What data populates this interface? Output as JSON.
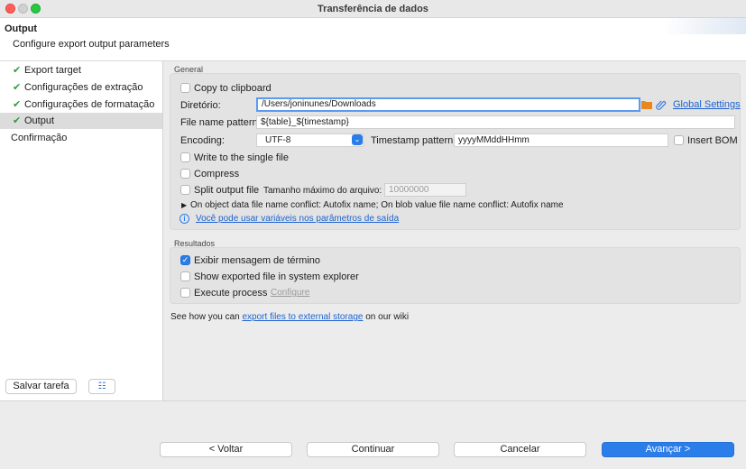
{
  "window": {
    "title": "Transferência de dados"
  },
  "header": {
    "title": "Output",
    "subtitle": "Configure export output parameters"
  },
  "sidebar": {
    "items": [
      {
        "label": "Export target",
        "checked": true,
        "active": false
      },
      {
        "label": "Configurações de extração",
        "checked": true,
        "active": false
      },
      {
        "label": "Configurações de formatação",
        "checked": true,
        "active": false
      },
      {
        "label": "Output",
        "checked": true,
        "active": true
      },
      {
        "label": "Confirmação",
        "checked": false,
        "active": false
      }
    ],
    "save_task_label": "Salvar tarefa",
    "tree_icon": "sitemap-icon"
  },
  "general": {
    "section_title": "General",
    "copy_to_clipboard": {
      "label": "Copy to clipboard",
      "checked": false
    },
    "directory": {
      "label": "Diretório:",
      "value": "/Users/joninunes/Downloads",
      "folder_icon": "folder-icon",
      "attach_icon": "paperclip-icon",
      "global_settings_label": "Global Settings"
    },
    "file_name_pattern": {
      "label": "File name pattern:",
      "value": "${table}_${timestamp}"
    },
    "encoding": {
      "label": "Encoding:",
      "value": "UTF-8"
    },
    "timestamp_pattern": {
      "label": "Timestamp pattern:",
      "value": "yyyyMMddHHmm"
    },
    "insert_bom": {
      "label": "Insert BOM",
      "checked": false
    },
    "write_single_file": {
      "label": "Write to the single file",
      "checked": false
    },
    "compress": {
      "label": "Compress",
      "checked": false
    },
    "split_output": {
      "label": "Split output file",
      "checked": false,
      "max_size_label": "Tamanho máximo do arquivo:",
      "max_size_value": "10000000"
    },
    "conflict_text": "On object data file name conflict: Autofix name; On blob value file name conflict: Autofix name",
    "variables_link": "Você pode usar variáveis nos parâmetros de saída"
  },
  "results": {
    "section_title": "Resultados",
    "show_message": {
      "label": "Exibir mensagem de término",
      "checked": true
    },
    "show_in_explorer": {
      "label": "Show exported file in system explorer",
      "checked": false
    },
    "execute_process": {
      "label": "Execute process",
      "checked": false,
      "configure_label": "Configure"
    }
  },
  "wiki": {
    "prefix": "See how you can ",
    "link": "export files to external storage",
    "suffix": " on our wiki"
  },
  "footer": {
    "back": "< Voltar",
    "continue": "Continuar",
    "cancel": "Cancelar",
    "next": "Avançar >"
  },
  "colors": {
    "accent": "#2b7de9",
    "link": "#1d63d1",
    "check": "#2e9e3c",
    "folder": "#e8871e"
  }
}
